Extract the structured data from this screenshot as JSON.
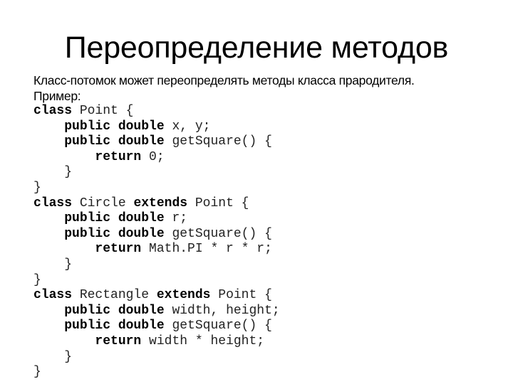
{
  "slide": {
    "title": "Переопределение методов",
    "intro": "Класс-потомок может переопределять методы класса прародителя.",
    "example_label": "Пример:"
  },
  "code": {
    "language": "Java",
    "lines": [
      [
        {
          "t": "class",
          "b": true
        },
        {
          "t": " Point {",
          "b": false
        }
      ],
      [
        {
          "t": "    ",
          "b": false
        },
        {
          "t": "public double",
          "b": true
        },
        {
          "t": " x, y;",
          "b": false
        }
      ],
      [
        {
          "t": "    ",
          "b": false
        },
        {
          "t": "public double",
          "b": true
        },
        {
          "t": " getSquare() {",
          "b": false
        }
      ],
      [
        {
          "t": "        ",
          "b": false
        },
        {
          "t": "return",
          "b": true
        },
        {
          "t": " 0;",
          "b": false
        }
      ],
      [
        {
          "t": "    }",
          "b": false
        }
      ],
      [
        {
          "t": "}",
          "b": false
        }
      ],
      [
        {
          "t": "class",
          "b": true
        },
        {
          "t": " Circle ",
          "b": false
        },
        {
          "t": "extends",
          "b": true
        },
        {
          "t": " Point {",
          "b": false
        }
      ],
      [
        {
          "t": "    ",
          "b": false
        },
        {
          "t": "public double",
          "b": true
        },
        {
          "t": " r;",
          "b": false
        }
      ],
      [
        {
          "t": "    ",
          "b": false
        },
        {
          "t": "public double",
          "b": true
        },
        {
          "t": " getSquare() {",
          "b": false
        }
      ],
      [
        {
          "t": "        ",
          "b": false
        },
        {
          "t": "return",
          "b": true
        },
        {
          "t": " Math.PI * r * r;",
          "b": false
        }
      ],
      [
        {
          "t": "    }",
          "b": false
        }
      ],
      [
        {
          "t": "}",
          "b": false
        }
      ],
      [
        {
          "t": "class",
          "b": true
        },
        {
          "t": " Rectangle ",
          "b": false
        },
        {
          "t": "extends",
          "b": true
        },
        {
          "t": " Point {",
          "b": false
        }
      ],
      [
        {
          "t": "    ",
          "b": false
        },
        {
          "t": "public double",
          "b": true
        },
        {
          "t": " width, height;",
          "b": false
        }
      ],
      [
        {
          "t": "    ",
          "b": false
        },
        {
          "t": "public double",
          "b": true
        },
        {
          "t": " getSquare() {",
          "b": false
        }
      ],
      [
        {
          "t": "        ",
          "b": false
        },
        {
          "t": "return",
          "b": true
        },
        {
          "t": " width * height;",
          "b": false
        }
      ],
      [
        {
          "t": "    }",
          "b": false
        }
      ],
      [
        {
          "t": "}",
          "b": false
        }
      ]
    ]
  }
}
